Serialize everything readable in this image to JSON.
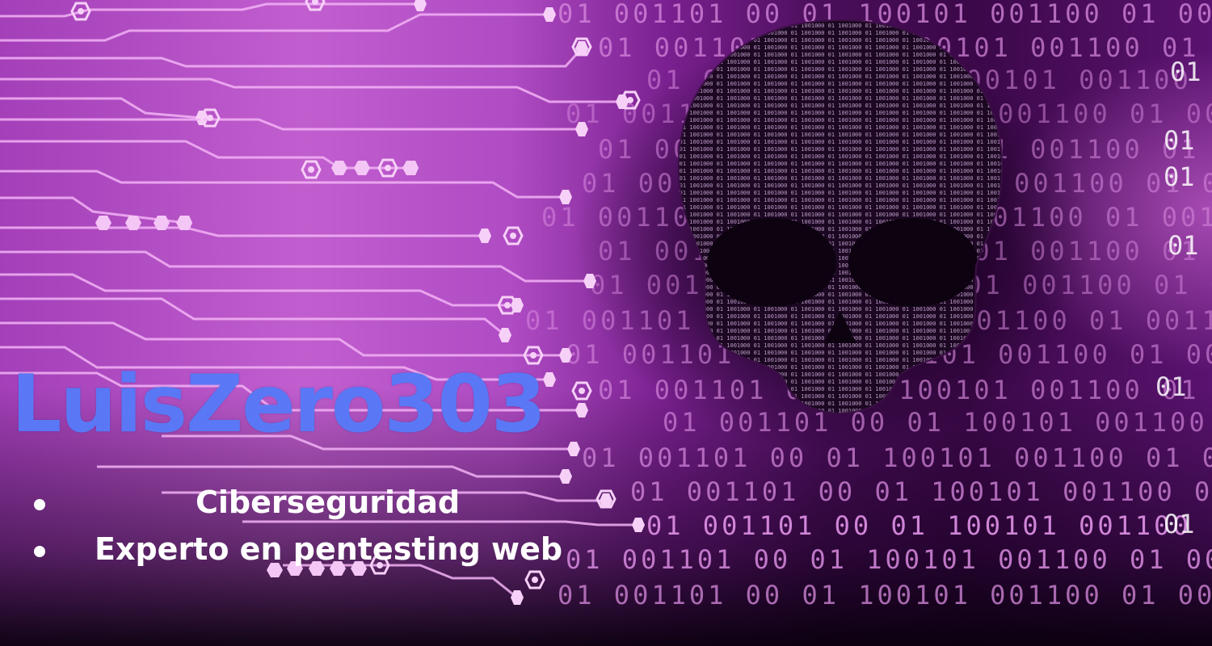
{
  "title": "LuisZero303",
  "bullets": [
    "Ciberseguridad",
    "Experto en pentesting web"
  ],
  "colors": {
    "title": "#5a78f5",
    "bullet_text": "#ffffff",
    "circuit_lines": "#f2b3f5",
    "binary_digits": "#d98ce0",
    "skull_digits": "#c9a7d4"
  },
  "background": {
    "left_motif": "circuit-board traces",
    "right_motif": "binary code rows",
    "center_motif": "skull made of binary digits"
  }
}
